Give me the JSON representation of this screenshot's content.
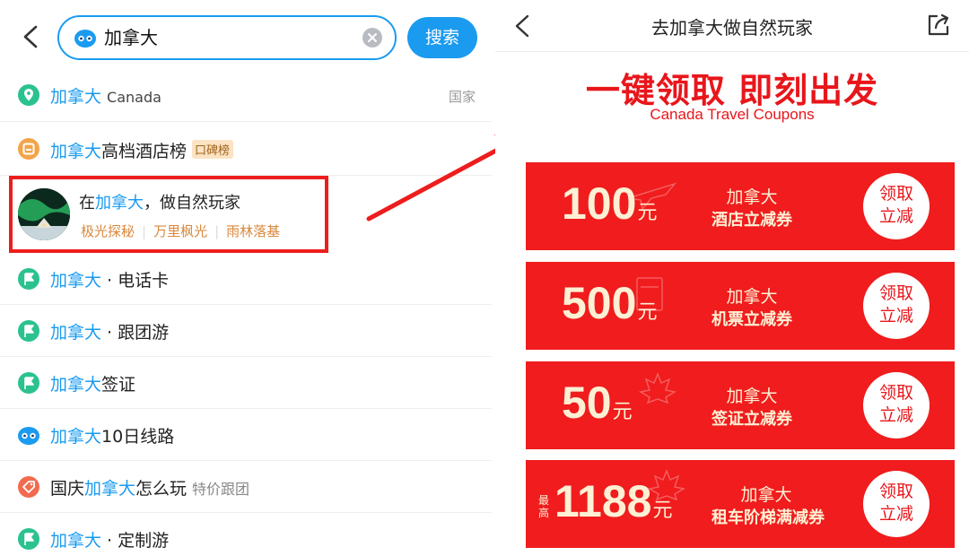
{
  "left_panel": {
    "search": {
      "value": "加拿大",
      "button": "搜索"
    },
    "items": [
      {
        "highlight": "加拿大",
        "rest": "",
        "extra": "Canada",
        "right_tag": "国家"
      },
      {
        "highlight": "加拿大",
        "rest": "高档酒店榜",
        "badge": "口碑榜"
      },
      {
        "highlight": "加拿大",
        "rest": " · 电话卡"
      },
      {
        "highlight": "加拿大",
        "rest": " · 跟团游"
      },
      {
        "highlight": "加拿大",
        "rest": "签证"
      },
      {
        "highlight": "加拿大",
        "rest": "10日线路"
      },
      {
        "prefix": "国庆",
        "highlight": "加拿大",
        "rest": "怎么玩",
        "extra": "特价跟团"
      },
      {
        "highlight": "加拿大",
        "rest": " · 定制游"
      }
    ],
    "featured": {
      "title_prefix": "在",
      "title_highlight": "加拿大",
      "title_rest": "，做自然玩家",
      "tags": [
        "极光探秘",
        "万里枫光",
        "雨林落基"
      ]
    }
  },
  "right_panel": {
    "header_title": "去加拿大做自然玩家",
    "hero_title": "一键领取 即刻出发",
    "hero_subtitle": "Canada Travel Coupons",
    "coupons": [
      {
        "prefix": "",
        "amount": "100",
        "unit": "元",
        "name": "加拿大",
        "desc": "酒店立减券",
        "btn_line1": "领取",
        "btn_line2": "立减"
      },
      {
        "prefix": "",
        "amount": "500",
        "unit": "元",
        "name": "加拿大",
        "desc": "机票立减券",
        "btn_line1": "领取",
        "btn_line2": "立减"
      },
      {
        "prefix": "",
        "amount": "50",
        "unit": "元",
        "name": "加拿大",
        "desc": "签证立减券",
        "btn_line1": "领取",
        "btn_line2": "立减"
      },
      {
        "prefix": "最高",
        "amount": "1188",
        "unit": "元",
        "name": "加拿大",
        "desc": "租车阶梯满减券",
        "btn_line1": "领取",
        "btn_line2": "立减"
      }
    ]
  },
  "colors": {
    "accent_blue": "#1a9bf0",
    "coupon_red": "#f01c1d",
    "highlight_red": "#ee1d1d",
    "tag_orange": "#d9883c"
  }
}
